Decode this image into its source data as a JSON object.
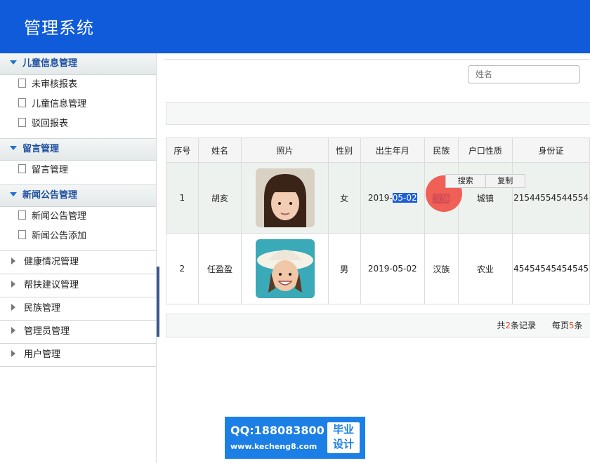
{
  "header": {
    "title": "管理系统"
  },
  "sidebar": {
    "groups": [
      {
        "label": "儿童信息管理",
        "items": [
          "未审核报表",
          "儿童信息管理",
          "驳回报表"
        ]
      },
      {
        "label": "留言管理",
        "items": [
          "留言管理"
        ]
      },
      {
        "label": "新闻公告管理",
        "items": [
          "新闻公告管理",
          "新闻公告添加"
        ]
      }
    ],
    "collapsed": [
      "健康情况管理",
      "帮扶建议管理",
      "民族管理",
      "管理员管理",
      "用户管理"
    ]
  },
  "search": {
    "placeholder": "姓名"
  },
  "table": {
    "headers": [
      "序号",
      "姓名",
      "照片",
      "性别",
      "出生年月",
      "民族",
      "户口性质",
      "身份证"
    ],
    "rows": [
      {
        "no": "1",
        "name": "胡亥",
        "gender": "女",
        "birth_pre": "2019-",
        "birth_sel": "05-02",
        "ethnic": "汉族",
        "hukou": "城镇",
        "id": "21544554544554"
      },
      {
        "no": "2",
        "name": "任盈盈",
        "gender": "男",
        "birth_pre": "2019-05-02",
        "birth_sel": "",
        "ethnic": "汉族",
        "hukou": "农业",
        "id": "45454545454545"
      }
    ]
  },
  "context_menu": [
    "搜索",
    "复制"
  ],
  "pager": {
    "pre1": "共",
    "total": "2",
    "post1": "条记录",
    "pre2": "每页",
    "per_page": "5",
    "post2": "条"
  },
  "watermark": {
    "qq": "QQ:188083800",
    "site": "www.kecheng8.com",
    "badge1": "毕业",
    "badge2": "设计"
  }
}
